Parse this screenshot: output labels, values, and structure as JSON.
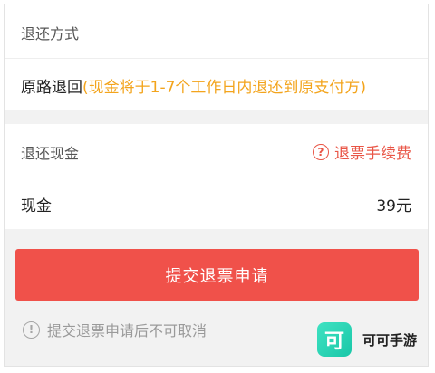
{
  "refund_method": {
    "label": "退还方式",
    "method": "原路退回",
    "method_note": "(现金将于1-7个工作日内退还到原支付方)"
  },
  "refund_cash": {
    "label": "退还现金",
    "fee_link_icon": "question-circle-icon",
    "fee_link_icon_glyph": "?",
    "fee_link": "退票手续费",
    "item_label": "现金",
    "item_value": "39元"
  },
  "submit_label": "提交退票申请",
  "notice": {
    "icon": "exclamation-circle-icon",
    "icon_glyph": "!",
    "text": "提交退票申请后不可取消"
  },
  "watermark": {
    "logo_glyph": "可",
    "name": "可可手游"
  },
  "colors": {
    "accent_red": "#f0514a",
    "note_amber": "#f3a41c",
    "link_red": "#e95546",
    "brand_teal": "#2fd6b8"
  }
}
